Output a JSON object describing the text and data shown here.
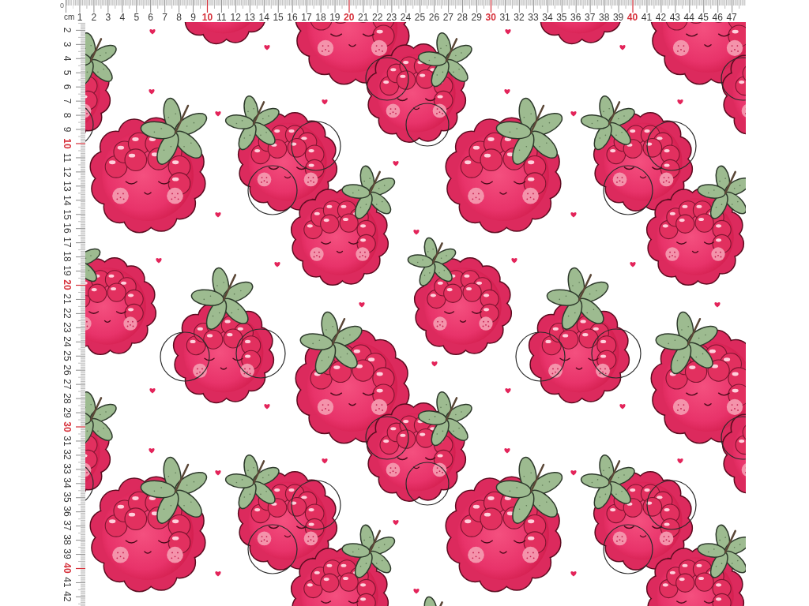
{
  "top_ruler": {
    "origin_label": "0",
    "unit": "cm",
    "marks": [
      {
        "label": "1",
        "major": false
      },
      {
        "label": "2",
        "major": false
      },
      {
        "label": "3",
        "major": false
      },
      {
        "label": "4",
        "major": false
      },
      {
        "label": "5",
        "major": false
      },
      {
        "label": "6",
        "major": false
      },
      {
        "label": "7",
        "major": false
      },
      {
        "label": "8",
        "major": false
      },
      {
        "label": "9",
        "major": false
      },
      {
        "label": "10",
        "major": true
      },
      {
        "label": "11",
        "major": false
      },
      {
        "label": "12",
        "major": false
      },
      {
        "label": "13",
        "major": false
      },
      {
        "label": "14",
        "major": false
      },
      {
        "label": "15",
        "major": false
      },
      {
        "label": "16",
        "major": false
      },
      {
        "label": "17",
        "major": false
      },
      {
        "label": "18",
        "major": false
      },
      {
        "label": "19",
        "major": false
      },
      {
        "label": "20",
        "major": true
      },
      {
        "label": "21",
        "major": false
      },
      {
        "label": "22",
        "major": false
      },
      {
        "label": "23",
        "major": false
      },
      {
        "label": "24",
        "major": false
      },
      {
        "label": "25",
        "major": false
      },
      {
        "label": "26",
        "major": false
      },
      {
        "label": "27",
        "major": false
      },
      {
        "label": "28",
        "major": false
      },
      {
        "label": "29",
        "major": false
      },
      {
        "label": "30",
        "major": true
      },
      {
        "label": "31",
        "major": false
      },
      {
        "label": "32",
        "major": false
      },
      {
        "label": "33",
        "major": false
      },
      {
        "label": "34",
        "major": false
      },
      {
        "label": "35",
        "major": false
      },
      {
        "label": "36",
        "major": false
      },
      {
        "label": "37",
        "major": false
      },
      {
        "label": "38",
        "major": false
      },
      {
        "label": "39",
        "major": false
      },
      {
        "label": "40",
        "major": true
      },
      {
        "label": "41",
        "major": false
      },
      {
        "label": "42",
        "major": false
      },
      {
        "label": "43",
        "major": false
      },
      {
        "label": "44",
        "major": false
      },
      {
        "label": "45",
        "major": false
      },
      {
        "label": "46",
        "major": false
      },
      {
        "label": "47",
        "major": false
      }
    ]
  },
  "left_ruler": {
    "marks": [
      {
        "label": "2",
        "major": false
      },
      {
        "label": "3",
        "major": false
      },
      {
        "label": "4",
        "major": false
      },
      {
        "label": "5",
        "major": false
      },
      {
        "label": "6",
        "major": false
      },
      {
        "label": "7",
        "major": false
      },
      {
        "label": "8",
        "major": false
      },
      {
        "label": "9",
        "major": false
      },
      {
        "label": "10",
        "major": true
      },
      {
        "label": "11",
        "major": false
      },
      {
        "label": "12",
        "major": false
      },
      {
        "label": "13",
        "major": false
      },
      {
        "label": "14",
        "major": false
      },
      {
        "label": "15",
        "major": false
      },
      {
        "label": "16",
        "major": false
      },
      {
        "label": "17",
        "major": false
      },
      {
        "label": "18",
        "major": false
      },
      {
        "label": "19",
        "major": false
      },
      {
        "label": "20",
        "major": true
      },
      {
        "label": "21",
        "major": false
      },
      {
        "label": "22",
        "major": false
      },
      {
        "label": "23",
        "major": false
      },
      {
        "label": "24",
        "major": false
      },
      {
        "label": "25",
        "major": false
      },
      {
        "label": "26",
        "major": false
      },
      {
        "label": "27",
        "major": false
      },
      {
        "label": "28",
        "major": false
      },
      {
        "label": "29",
        "major": false
      },
      {
        "label": "30",
        "major": true
      },
      {
        "label": "31",
        "major": false
      },
      {
        "label": "32",
        "major": false
      },
      {
        "label": "33",
        "major": false
      },
      {
        "label": "34",
        "major": false
      },
      {
        "label": "35",
        "major": false
      },
      {
        "label": "36",
        "major": false
      },
      {
        "label": "37",
        "major": false
      },
      {
        "label": "38",
        "major": false
      },
      {
        "label": "39",
        "major": false
      },
      {
        "label": "40",
        "major": true
      },
      {
        "label": "41",
        "major": false
      },
      {
        "label": "42",
        "major": false
      }
    ]
  }
}
